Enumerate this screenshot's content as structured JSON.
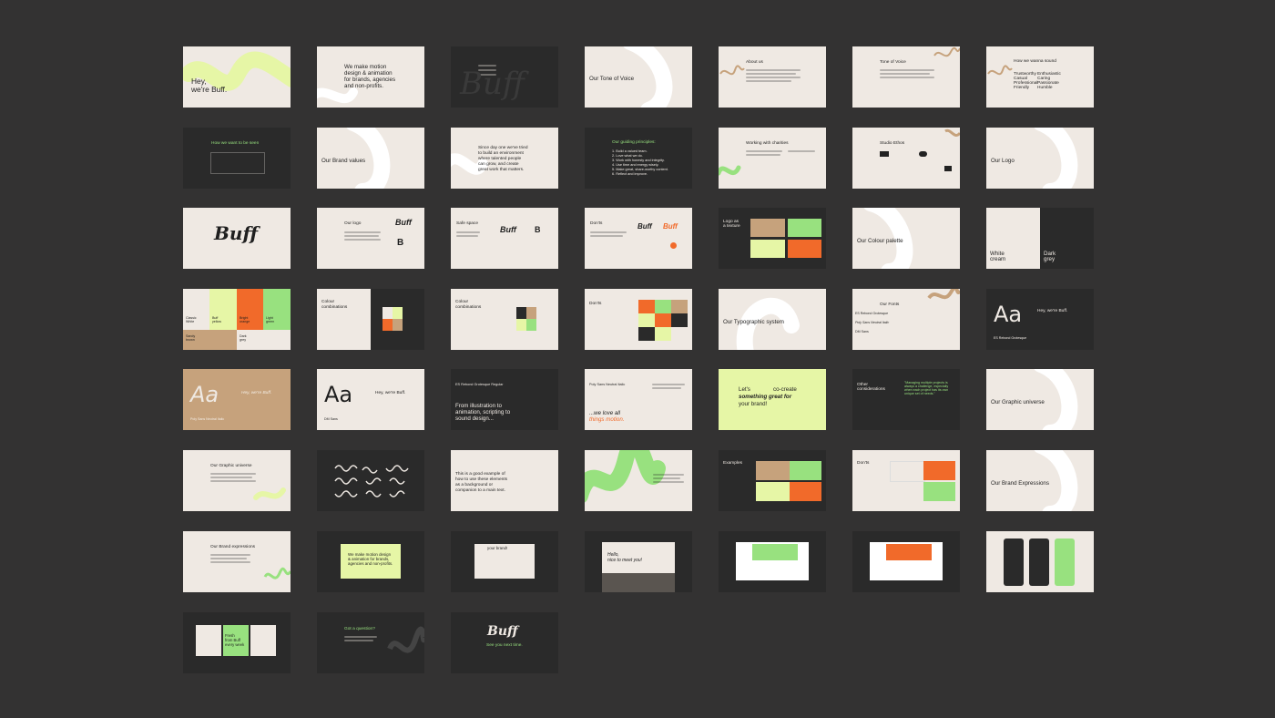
{
  "colors": {
    "background": "#333232",
    "cream": "#efe9e3",
    "dark": "#2a2a2a",
    "lime": "#dff79a",
    "green": "#98e17f",
    "orange": "#f16a2a",
    "tan": "#c6a27c"
  },
  "slides": [
    {
      "id": "s1",
      "text": [
        "Hey,",
        "we're Buff."
      ]
    },
    {
      "id": "s2",
      "text": [
        "We make motion",
        "design & animation",
        "for brands, agencies",
        "and non-profits."
      ]
    },
    {
      "id": "s3",
      "text": [
        "Buff"
      ]
    },
    {
      "id": "s4",
      "text": [
        "Our Tone of Voice"
      ]
    },
    {
      "id": "s5",
      "text": [
        "About us"
      ]
    },
    {
      "id": "s6",
      "text": [
        "Tone of Voice"
      ]
    },
    {
      "id": "s7",
      "text": [
        "How we wanna sound",
        "Trustworthy",
        "Casual",
        "Professional",
        "Friendly",
        "Enthusiastic",
        "Caring",
        "Passionate",
        "Humble"
      ]
    },
    {
      "id": "s8",
      "text": [
        "How we want to be seen"
      ]
    },
    {
      "id": "s9",
      "text": [
        "Our Brand values"
      ]
    },
    {
      "id": "s10",
      "text": [
        "Since day one we've tried",
        "to build an environment",
        "where talented people",
        "can grow, and create",
        "great work that matters."
      ]
    },
    {
      "id": "s11",
      "text": [
        "Our guiding principles:",
        "1. Build a valued team.",
        "2. Love what we do.",
        "3. Work with honesty and integrity.",
        "4. Use time and energy wisely.",
        "5. Make great, share-worthy content.",
        "6. Reflect and improve."
      ]
    },
    {
      "id": "s12",
      "text": [
        "Working with charities"
      ]
    },
    {
      "id": "s13",
      "text": [
        "Studio Ethos"
      ]
    },
    {
      "id": "s14",
      "text": [
        "Our Logo"
      ]
    },
    {
      "id": "s15",
      "text": [
        "Buff"
      ]
    },
    {
      "id": "s16",
      "text": [
        "Our logo",
        "Buff",
        "B"
      ]
    },
    {
      "id": "s17",
      "text": [
        "Safe space",
        "Buff",
        "B"
      ]
    },
    {
      "id": "s18",
      "text": [
        "Don'ts",
        "Buff",
        "Buff"
      ]
    },
    {
      "id": "s19",
      "text": [
        "Logo as",
        "a texture"
      ]
    },
    {
      "id": "s20",
      "text": [
        "Our Colour palette"
      ]
    },
    {
      "id": "s21",
      "text": [
        "White",
        "cream",
        "Dark",
        "grey"
      ]
    },
    {
      "id": "s22",
      "text": [
        "Classic",
        "White",
        "Buff",
        "yellow",
        "Bright",
        "orange",
        "Light",
        "green",
        "Sandy",
        "brown",
        "Dark",
        "grey"
      ]
    },
    {
      "id": "s23",
      "text": [
        "Colour",
        "combinations"
      ]
    },
    {
      "id": "s24",
      "text": [
        "Colour",
        "combinations"
      ]
    },
    {
      "id": "s25",
      "text": [
        "Don'ts"
      ]
    },
    {
      "id": "s26",
      "text": [
        "Our Typographic system"
      ]
    },
    {
      "id": "s27",
      "text": [
        "Our Fonts",
        "ES Rebond Grotesque",
        "Poly Sans Neutral Italic",
        "DM Sans"
      ]
    },
    {
      "id": "s28",
      "text": [
        "Aa",
        "Hey, we're Buff.",
        "ES Rebond Grotesque"
      ]
    },
    {
      "id": "s29",
      "text": [
        "Aa",
        "Hey, we're Buff.",
        "Poly Sans Neutral Italic"
      ]
    },
    {
      "id": "s30",
      "text": [
        "Aa",
        "Hey, we're Buff.",
        "DM Sans"
      ]
    },
    {
      "id": "s31",
      "text": [
        "ES Rebond Grotesque Regular",
        "From illustration to",
        "animation, scripting to",
        "sound design..."
      ]
    },
    {
      "id": "s32",
      "text": [
        "Poly Sans Neutral Italic",
        "...we love all",
        "things motion."
      ]
    },
    {
      "id": "s33",
      "text": [
        "Let's",
        "co-create",
        "something great for",
        "your brand!"
      ]
    },
    {
      "id": "s34",
      "text": [
        "Other",
        "considerations",
        "\"Managing multiple projects is",
        "always a challenge, especially",
        "when each project has its own",
        "unique set of needs.\""
      ]
    },
    {
      "id": "s35",
      "text": [
        "Our Graphic universe"
      ]
    },
    {
      "id": "s36",
      "text": [
        "Our Graphic universe"
      ]
    },
    {
      "id": "s37",
      "text": []
    },
    {
      "id": "s38",
      "text": [
        "This is a good example of",
        "how to use these elements",
        "as a background or",
        "companion to a main text."
      ]
    },
    {
      "id": "s39",
      "text": []
    },
    {
      "id": "s40",
      "text": [
        "Examples"
      ]
    },
    {
      "id": "s41",
      "text": [
        "Don'ts"
      ]
    },
    {
      "id": "s42",
      "text": [
        "Our Brand Expressions"
      ]
    },
    {
      "id": "s43",
      "text": [
        "Our Brand expressions"
      ]
    },
    {
      "id": "s44",
      "text": [
        "We make motion design",
        "& animation for brands,",
        "agencies and non-profits."
      ]
    },
    {
      "id": "s45",
      "text": [
        "your brand!"
      ]
    },
    {
      "id": "s46",
      "text": [
        "Hello,",
        "nice to meet you!"
      ]
    },
    {
      "id": "s47",
      "text": []
    },
    {
      "id": "s48",
      "text": []
    },
    {
      "id": "s49",
      "text": []
    },
    {
      "id": "s50",
      "text": [
        "Fresh",
        "from Buff",
        "every week"
      ]
    },
    {
      "id": "s51",
      "text": [
        "Got a question?"
      ]
    },
    {
      "id": "s52",
      "text": [
        "Buff",
        "See you next time."
      ]
    }
  ]
}
